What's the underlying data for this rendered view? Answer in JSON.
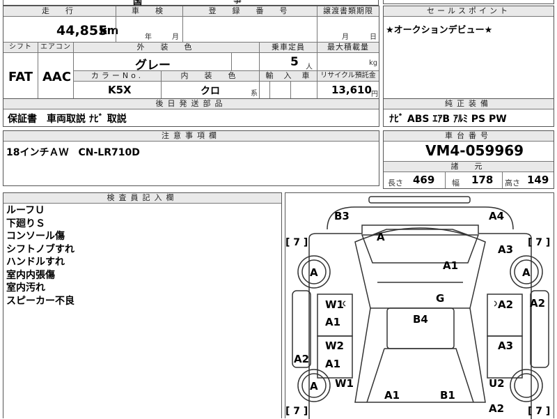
{
  "top_strip": {
    "partial_text": "国",
    "partial_text2": "事"
  },
  "mileage": {
    "header": "走　行",
    "value": "44,855",
    "unit": "km"
  },
  "inspection": {
    "header": "車　検",
    "year_label": "年",
    "month_label": "月"
  },
  "registration": {
    "header": "登　録　番　号"
  },
  "transfer": {
    "header": "譲渡書類期限",
    "month_label": "月",
    "day_label": "日"
  },
  "sales_point": {
    "header": "セールスポイント",
    "text": "★オークションデビュー★"
  },
  "shift": {
    "header": "シフト",
    "value": "FAT"
  },
  "aircon": {
    "header": "エアコン",
    "value": "AAC"
  },
  "exterior": {
    "header": "外　装　色",
    "value": "グレー"
  },
  "capacity": {
    "header": "乗車定員",
    "value": "5",
    "unit": "人"
  },
  "max_load": {
    "header": "最大積載量",
    "unit": "kg"
  },
  "color_no": {
    "header": "カラーNo.",
    "value": "K5X"
  },
  "interior": {
    "header": "内　装　色",
    "value": "クロ",
    "suffix": "系"
  },
  "import": {
    "header": "輸　入　車"
  },
  "recycle": {
    "header": "リサイクル預託金",
    "value": "13,610",
    "unit": "円"
  },
  "later_parts": {
    "header": "後日発送部品",
    "text": "保証書　車両取説  ﾅﾋﾞ 取説"
  },
  "genuine_equip": {
    "header": "純正装備",
    "text": "ﾅﾋﾞ  ABS  ｴｱB  ｱﾙﾐ  PS  PW"
  },
  "notes": {
    "header": "注意事項欄",
    "text": "18インチＡＷ　CN-LR710D"
  },
  "chassis": {
    "header": "車台番号",
    "value": "VM4-059969"
  },
  "specs": {
    "header": "諸　元",
    "length_label": "長さ",
    "length": "469",
    "width_label": "幅",
    "width": "178",
    "height_label": "高さ",
    "height": "149"
  },
  "inspector": {
    "header": "検査員記入欄",
    "lines": [
      "ルーフＵ",
      "下廻りＳ",
      "コンソール傷",
      "シフトノブすれ",
      "ハンドルすれ",
      "室内内張傷",
      "室内汚れ",
      "スピーカー不良"
    ]
  },
  "diagram": {
    "labels": [
      {
        "id": "b3",
        "text": "B3"
      },
      {
        "id": "a4",
        "text": "A4"
      },
      {
        "id": "a-front",
        "text": "A"
      },
      {
        "id": "bracket-l1",
        "text": "[ 7 ]"
      },
      {
        "id": "bracket-r1",
        "text": "[ 7 ]"
      },
      {
        "id": "a3-top",
        "text": "A3"
      },
      {
        "id": "a1-hood",
        "text": "A1"
      },
      {
        "id": "tire-fl",
        "text": "A"
      },
      {
        "id": "tire-fr",
        "text": "A"
      },
      {
        "id": "g",
        "text": "G"
      },
      {
        "id": "w1-l",
        "text": "W1"
      },
      {
        "id": "a1-l1",
        "text": "A1"
      },
      {
        "id": "b4",
        "text": "B4"
      },
      {
        "id": "a2-r1",
        "text": "A2"
      },
      {
        "id": "a2-redge",
        "text": "A2"
      },
      {
        "id": "w2",
        "text": "W2"
      },
      {
        "id": "a1-l2",
        "text": "A1"
      },
      {
        "id": "a3-r",
        "text": "A3"
      },
      {
        "id": "a2-ledge",
        "text": "A2"
      },
      {
        "id": "tire-rl",
        "text": "A"
      },
      {
        "id": "w1-rear",
        "text": "W1"
      },
      {
        "id": "u2",
        "text": "U2"
      },
      {
        "id": "a1-trunk",
        "text": "A1"
      },
      {
        "id": "b1",
        "text": "B1"
      },
      {
        "id": "bracket-l2",
        "text": "[ 7 ]"
      },
      {
        "id": "bracket-r2",
        "text": "[ 7 ]"
      },
      {
        "id": "a2-bottom",
        "text": "A2"
      }
    ]
  }
}
